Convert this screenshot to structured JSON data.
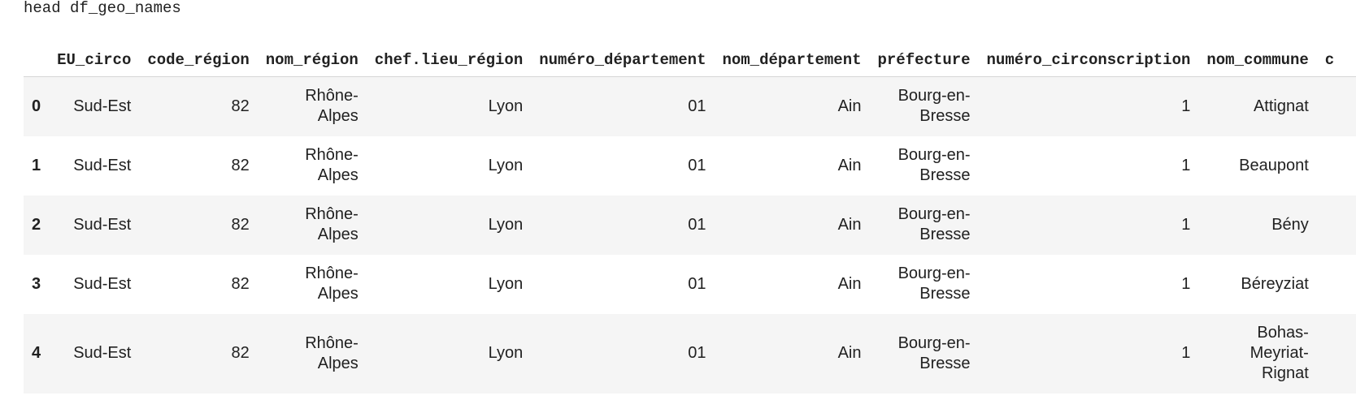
{
  "code": "head df_geo_names",
  "table": {
    "columns": [
      "",
      "EU_circo",
      "code_région",
      "nom_région",
      "chef.lieu_région",
      "numéro_département",
      "nom_département",
      "préfecture",
      "numéro_circonscription",
      "nom_commune",
      "c"
    ],
    "rows": [
      {
        "index": "0",
        "eu_circo": "Sud-Est",
        "code_region": "82",
        "nom_region_1": "Rhône-",
        "nom_region_2": "Alpes",
        "chef_lieu": "Lyon",
        "numero_dept": "01",
        "nom_dept": "Ain",
        "prefecture_1": "Bourg-en-",
        "prefecture_2": "Bresse",
        "numero_circ": "1",
        "nom_commune_1": "Attignat",
        "nom_commune_2": "",
        "nom_commune_3": ""
      },
      {
        "index": "1",
        "eu_circo": "Sud-Est",
        "code_region": "82",
        "nom_region_1": "Rhône-",
        "nom_region_2": "Alpes",
        "chef_lieu": "Lyon",
        "numero_dept": "01",
        "nom_dept": "Ain",
        "prefecture_1": "Bourg-en-",
        "prefecture_2": "Bresse",
        "numero_circ": "1",
        "nom_commune_1": "Beaupont",
        "nom_commune_2": "",
        "nom_commune_3": ""
      },
      {
        "index": "2",
        "eu_circo": "Sud-Est",
        "code_region": "82",
        "nom_region_1": "Rhône-",
        "nom_region_2": "Alpes",
        "chef_lieu": "Lyon",
        "numero_dept": "01",
        "nom_dept": "Ain",
        "prefecture_1": "Bourg-en-",
        "prefecture_2": "Bresse",
        "numero_circ": "1",
        "nom_commune_1": "Bény",
        "nom_commune_2": "",
        "nom_commune_3": ""
      },
      {
        "index": "3",
        "eu_circo": "Sud-Est",
        "code_region": "82",
        "nom_region_1": "Rhône-",
        "nom_region_2": "Alpes",
        "chef_lieu": "Lyon",
        "numero_dept": "01",
        "nom_dept": "Ain",
        "prefecture_1": "Bourg-en-",
        "prefecture_2": "Bresse",
        "numero_circ": "1",
        "nom_commune_1": "Béreyziat",
        "nom_commune_2": "",
        "nom_commune_3": ""
      },
      {
        "index": "4",
        "eu_circo": "Sud-Est",
        "code_region": "82",
        "nom_region_1": "Rhône-",
        "nom_region_2": "Alpes",
        "chef_lieu": "Lyon",
        "numero_dept": "01",
        "nom_dept": "Ain",
        "prefecture_1": "Bourg-en-",
        "prefecture_2": "Bresse",
        "numero_circ": "1",
        "nom_commune_1": "Bohas-",
        "nom_commune_2": "Meyriat-",
        "nom_commune_3": "Rignat"
      }
    ]
  }
}
